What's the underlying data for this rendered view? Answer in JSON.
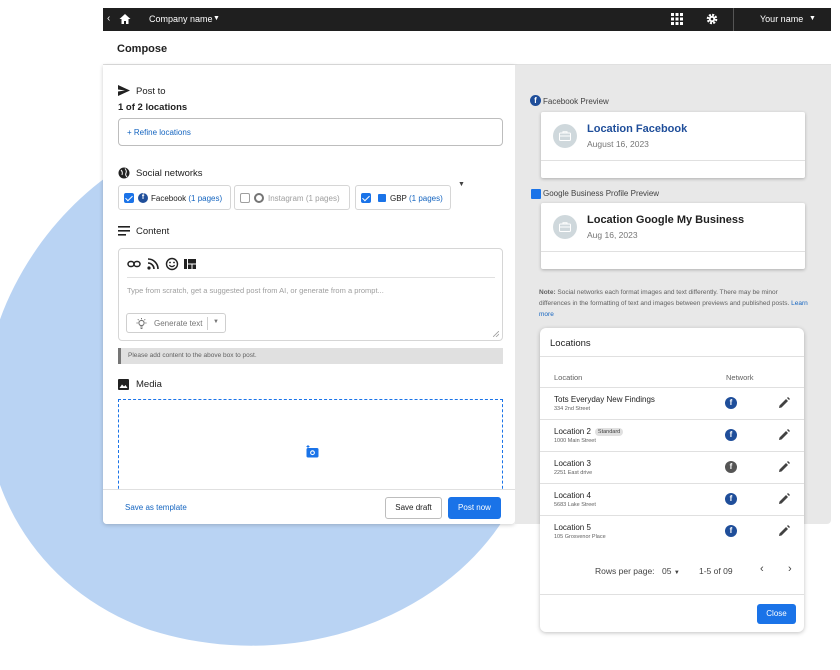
{
  "topbar": {
    "company": "Company name",
    "user": "Your name"
  },
  "compose": {
    "title": "Compose"
  },
  "post_to": {
    "label": "Post to",
    "count": "1 of 2 locations",
    "refine": "+ Refine locations"
  },
  "social": {
    "label": "Social networks",
    "facebook": {
      "name": "Facebook",
      "pages": "(1 pages)"
    },
    "instagram": {
      "name": "Instagram",
      "pages": "(1 pages)"
    },
    "gbp": {
      "name": "GBP",
      "pages": "(1 pages)"
    }
  },
  "content": {
    "label": "Content",
    "placeholder": "Type from scratch, get a suggested post from AI, or generate from a prompt...",
    "generate": "Generate text",
    "notice": "Please add content to the above box to post."
  },
  "media": {
    "label": "Media"
  },
  "footer": {
    "template": "Save as template",
    "draft": "Save draft",
    "post": "Post now"
  },
  "preview": {
    "facebook_label": "Facebook Preview",
    "facebook_name": "Location Facebook",
    "facebook_date": "August 16, 2023",
    "gbp_label": "Google Business Profile Preview",
    "gbp_name": "Location Google My Business",
    "gbp_date": "Aug 16, 2023",
    "note_bold": "Note:",
    "note_text": " Social networks each format images and text differently. There may be minor differences in the formatting of text and images between previews and published posts. ",
    "learn_more": "Learn more"
  },
  "locations": {
    "title": "Locations",
    "col_location": "Location",
    "col_network": "Network",
    "rows": [
      {
        "name": "Tots Everyday New Findings",
        "address": "334 2nd Street",
        "badge": "",
        "network": "f"
      },
      {
        "name": "Location 2",
        "address": "1000 Main Street",
        "badge": "Standard",
        "network": "f"
      },
      {
        "name": "Location 3",
        "address": "2251 East drive",
        "badge": "",
        "network": "f"
      },
      {
        "name": "Location 4",
        "address": "5683 Lake Street",
        "badge": "",
        "network": "f"
      },
      {
        "name": "Location 5",
        "address": "105 Grosvenor Place",
        "badge": "",
        "network": "f"
      }
    ],
    "rows_per_page_label": "Rows per page:",
    "rows_per_page": "05",
    "range": "1-5 of 09",
    "close": "Close"
  },
  "colors": {
    "accent": "#1a73e8",
    "facebook": "#1f4e9a",
    "blob": "#b9d3f3"
  }
}
